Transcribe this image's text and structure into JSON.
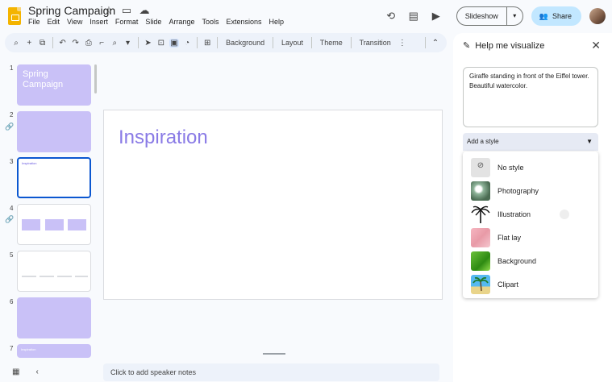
{
  "app": {
    "title": "Spring Campaign",
    "menu": [
      "File",
      "Edit",
      "View",
      "Insert",
      "Format",
      "Slide",
      "Arrange",
      "Tools",
      "Extensions",
      "Help"
    ],
    "slideshow_label": "Slideshow",
    "share_label": "Share"
  },
  "toolbar": {
    "background_label": "Background",
    "layout_label": "Layout",
    "theme_label": "Theme",
    "transition_label": "Transition"
  },
  "filmstrip": {
    "slides": [
      {
        "num": "1",
        "title": "Spring Campaign"
      },
      {
        "num": "2",
        "title": ""
      },
      {
        "num": "3",
        "title": "Inspiration"
      },
      {
        "num": "4",
        "title": ""
      },
      {
        "num": "5",
        "title": ""
      },
      {
        "num": "6",
        "title": ""
      },
      {
        "num": "7",
        "title": "Inspiration"
      }
    ]
  },
  "slide": {
    "title": "Inspiration"
  },
  "notes": {
    "placeholder": "Click to add speaker notes"
  },
  "panel": {
    "title": "Help me visualize",
    "prompt": "Giraffe standing in front of the Eiffel tower. Beautiful watercolor.",
    "style_placeholder": "Add a style",
    "styles": [
      "No style",
      "Photography",
      "Illustration",
      "Flat lay",
      "Background",
      "Clipart"
    ]
  },
  "colors": {
    "accent": "#0b57d0",
    "share_bg": "#c2e7ff",
    "slide_title": "#8a7be6",
    "thumb_purple": "#c9c1f7"
  }
}
